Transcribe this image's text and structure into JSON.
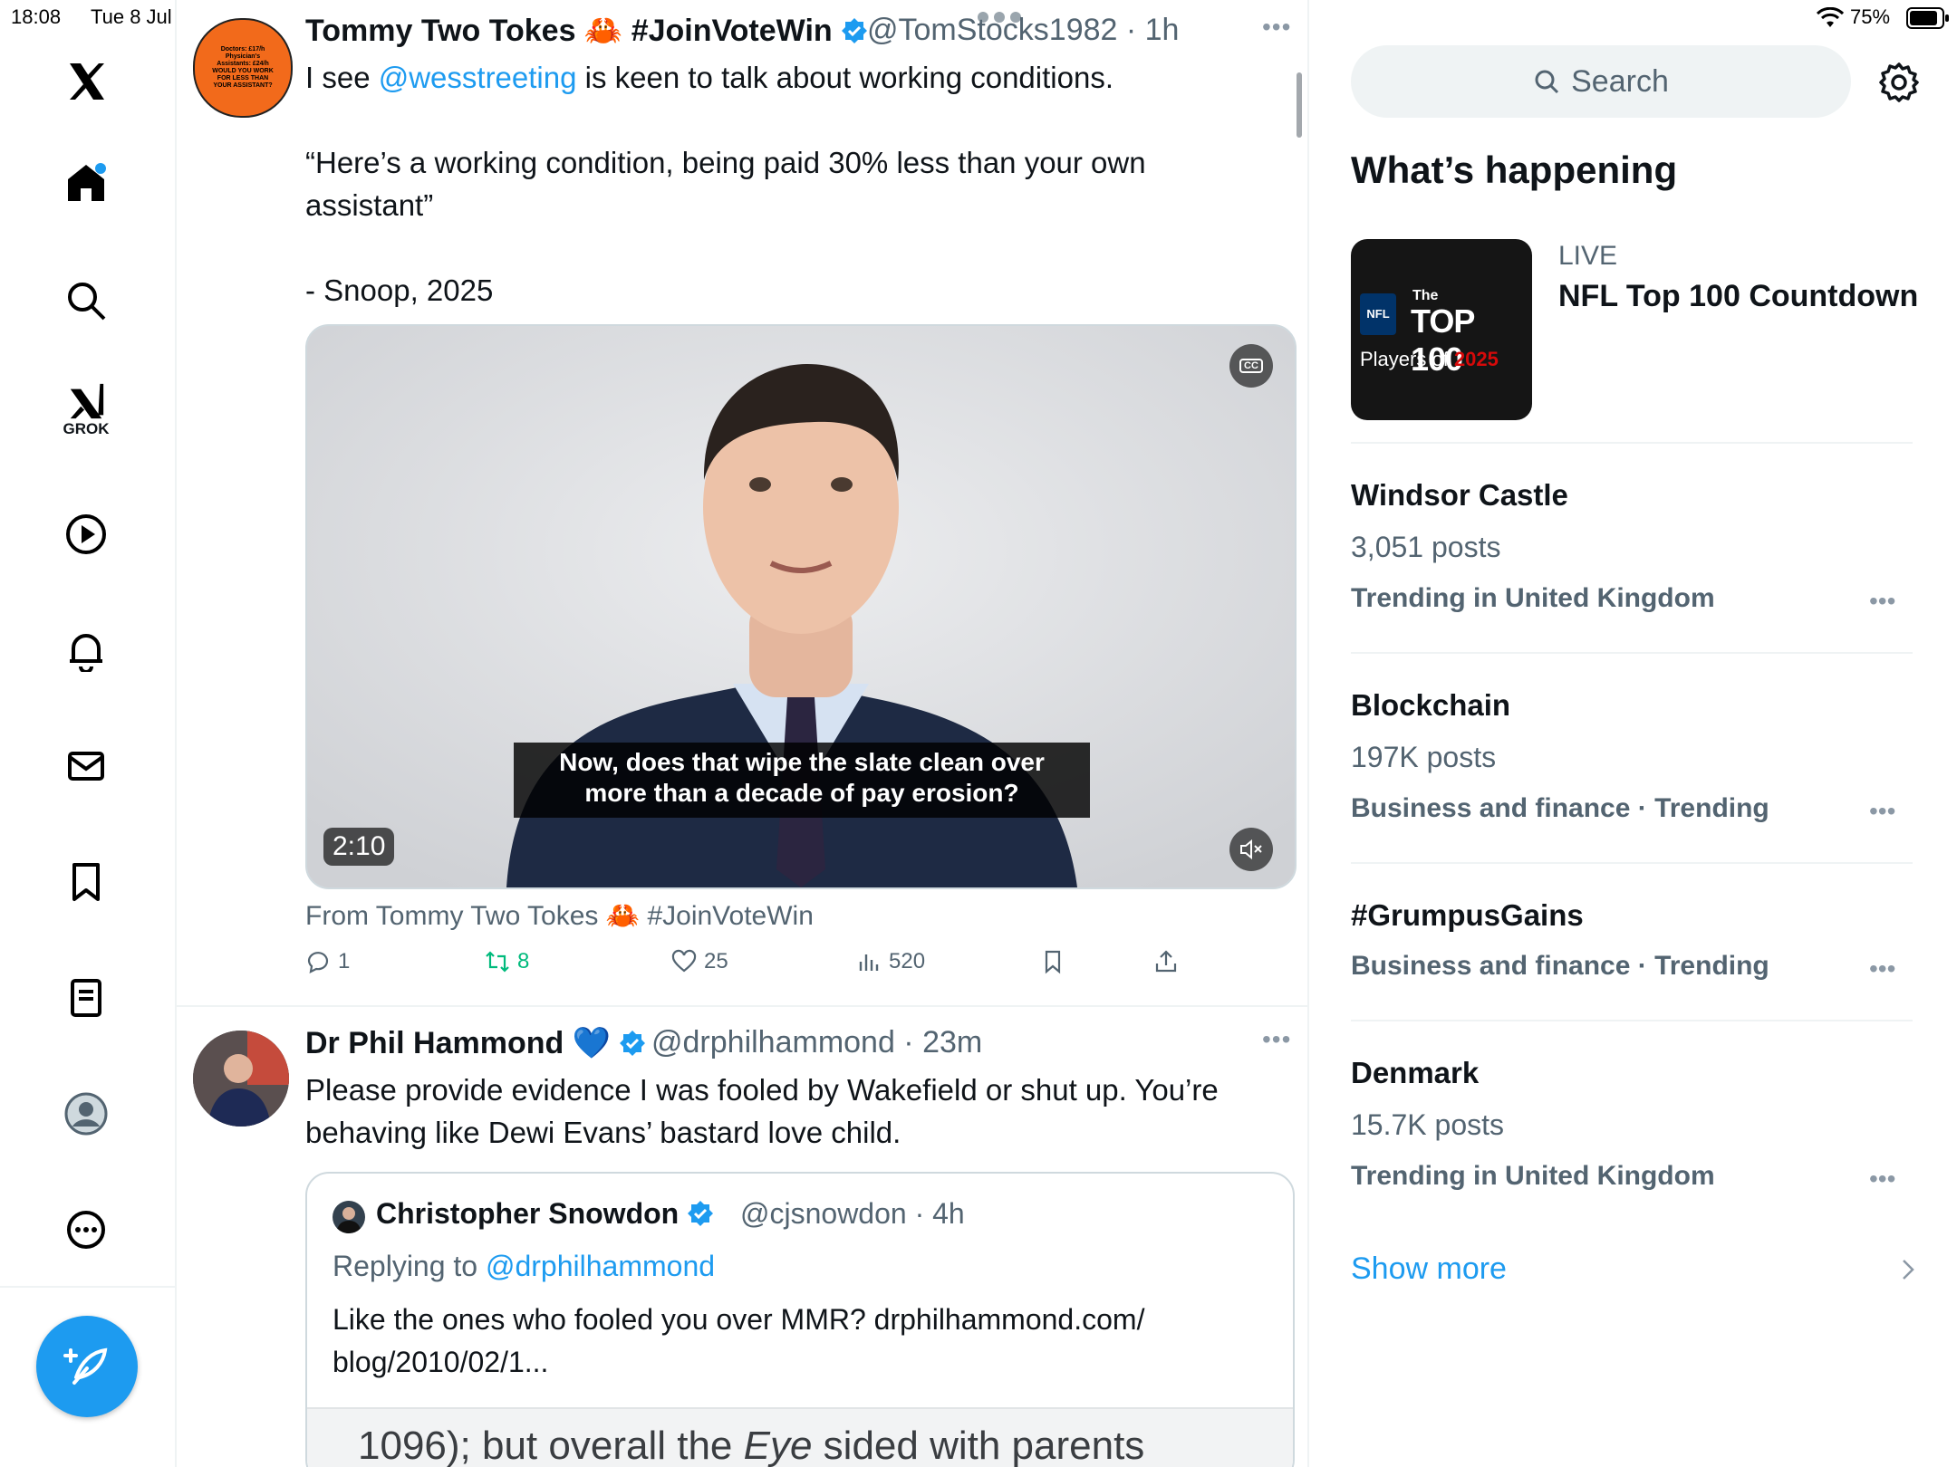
{
  "status_bar": {
    "time": "18:08",
    "date": "Tue 8 Jul",
    "battery": "75%"
  },
  "nav": {
    "grok_label": "GROK",
    "items": [
      "home-icon",
      "explore-icon",
      "grok-icon",
      "video-icon",
      "notifications-icon",
      "messages-icon",
      "bookmarks-icon",
      "lists-icon",
      "profile-icon",
      "more-icon"
    ]
  },
  "tweet1": {
    "name": "Tommy Two Tokes 🦀 #JoinVoteWin",
    "handle": "@TomStocks1982 · 1h",
    "avatar_text": "Doctors: £17/h Physician's Assistants: £24/h WOULD YOU WORK FOR LESS THAN YOUR ASSISTANT?",
    "text_pre": "I see ",
    "mention": "@wesstreeting",
    "text_post": " is keen to talk about working conditions.",
    "quote": "“Here’s a working condition, being paid 30% less than your own assistant”",
    "sign": "- Snoop, 2025",
    "video_caption_line1": "Now, does that wipe the slate clean over",
    "video_caption_line2": "more than a decade of pay erosion?",
    "video_duration": "2:10",
    "video_cc": "CC",
    "from_label": "From Tommy Two Tokes 🦀 #JoinVoteWin",
    "replies": "1",
    "reposts": "8",
    "likes": "25",
    "views": "520"
  },
  "tweet2": {
    "name": "Dr Phil Hammond 💙",
    "handle": "@drphilhammond · 23m",
    "text": "Please provide evidence I was fooled by Wakefield or shut up. You’re behaving like Dewi Evans’ bastard love child.",
    "quoted": {
      "name": "Christopher Snowdon",
      "handle": "@cjsnowdon · 4h",
      "replying_prefix": "Replying to ",
      "replying_to": "@drphilhammond",
      "text": "Like the ones who fooled you over MMR? drphilhammond.com/ blog/2010/02/1...",
      "image_text_pre": "1096); but overall the ",
      "image_text_em": "Eye",
      "image_text_post": " sided with parents"
    }
  },
  "right": {
    "search_placeholder": "Search",
    "heading": "What’s happening",
    "featured": {
      "live": "LIVE",
      "title": "NFL Top 100 Countdown",
      "thumb_the": "The",
      "thumb_top": "TOP 100",
      "thumb_players": "Players of ",
      "thumb_year": "2025",
      "thumb_nfl": "NFL"
    },
    "trends": [
      {
        "title": "Windsor Castle",
        "posts": "3,051 posts",
        "meta": "Trending in United Kingdom"
      },
      {
        "title": "Blockchain",
        "posts": "197K posts",
        "meta": "Business and finance · Trending"
      },
      {
        "title": "#GrumpusGains",
        "posts": "",
        "meta": "Business and finance · Trending"
      },
      {
        "title": "Denmark",
        "posts": "15.7K posts",
        "meta": "Trending in United Kingdom"
      }
    ],
    "show_more": "Show more"
  },
  "colors": {
    "accent": "#1d9bf0",
    "repost": "#00ba7c",
    "text": "#0f1419",
    "muted": "#536471"
  }
}
